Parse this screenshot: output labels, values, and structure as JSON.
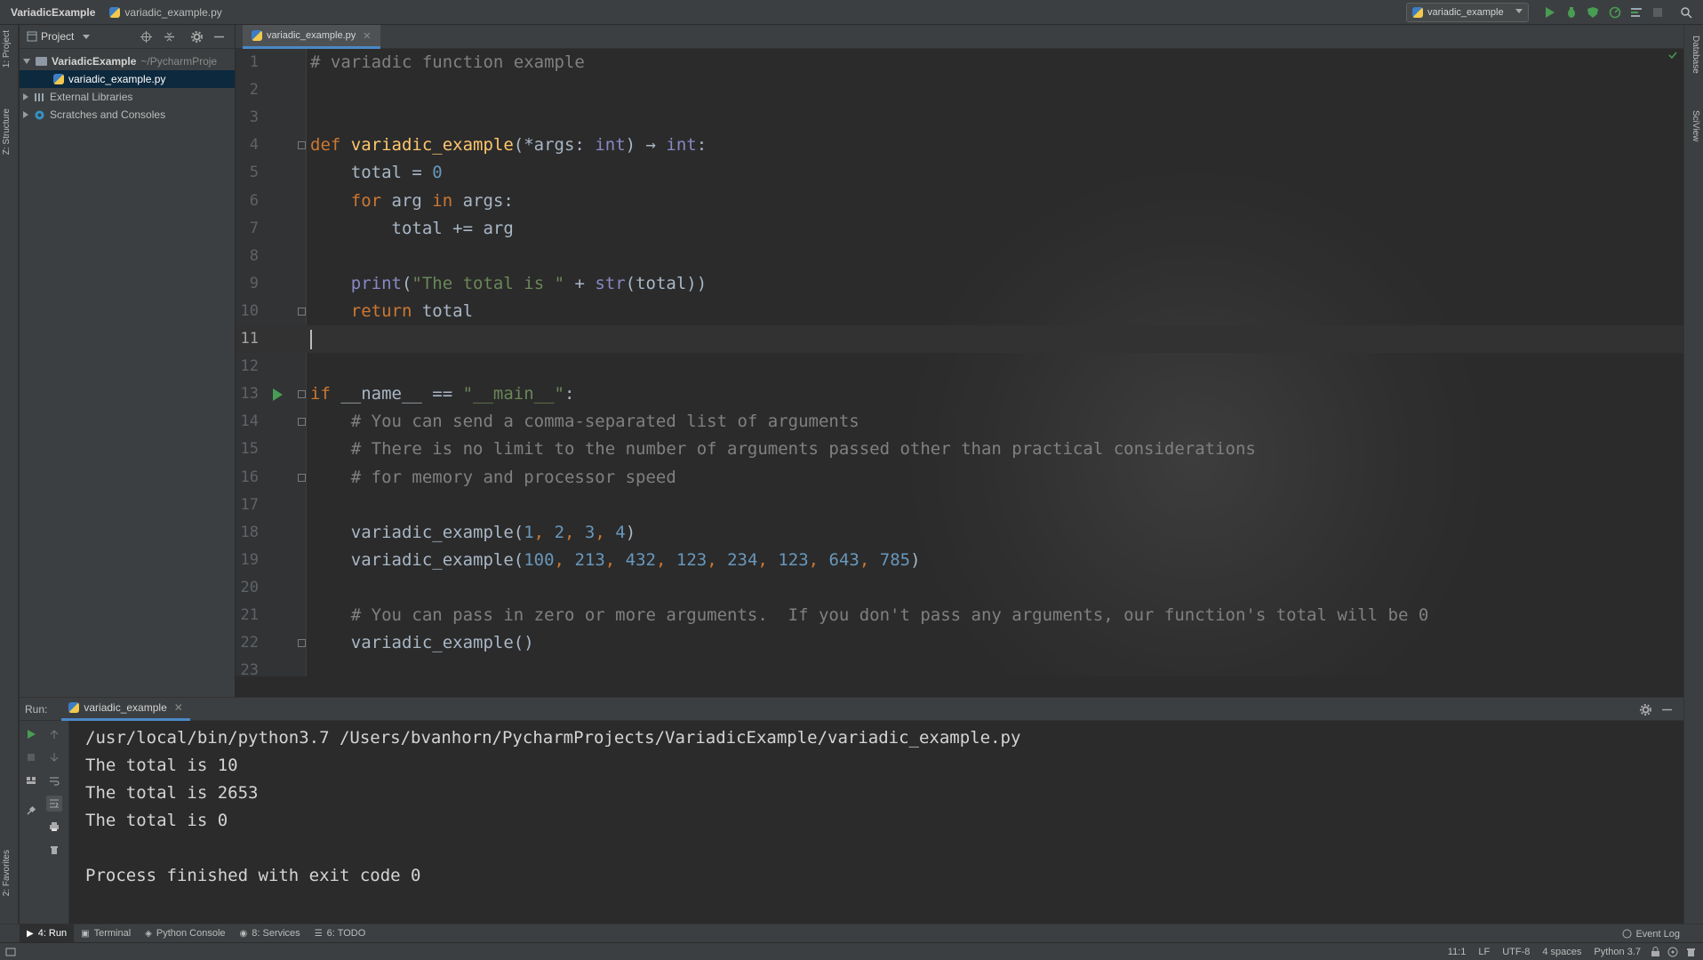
{
  "titlebar": {
    "project": "VariadicExample",
    "file": "variadic_example.py",
    "run_config": "variadic_example"
  },
  "left_stripe": {
    "project_tab": "1: Project",
    "structure_tab": "Z: Structure",
    "favorites_tab": "2: Favorites"
  },
  "right_stripe": {
    "database_tab": "Database",
    "sciview_tab": "SciView"
  },
  "project_panel": {
    "title": "Project",
    "tree": [
      {
        "label": "VariadicExample",
        "path": "~/PycharmProje"
      },
      {
        "label": "variadic_example.py"
      },
      {
        "label": "External Libraries"
      },
      {
        "label": "Scratches and Consoles"
      }
    ]
  },
  "editor": {
    "tab": "variadic_example.py",
    "current_line": 11,
    "lines": [
      {
        "n": "1",
        "s": [
          {
            "t": "# variadic function example",
            "c": "cm"
          }
        ]
      },
      {
        "n": "2",
        "s": []
      },
      {
        "n": "3",
        "s": []
      },
      {
        "n": "4",
        "s": [
          {
            "t": "def ",
            "c": "kw"
          },
          {
            "t": "variadic_example",
            "c": "fn"
          },
          {
            "t": "(*args: ",
            "c": ""
          },
          {
            "t": "int",
            "c": "bi"
          },
          {
            "t": ") → ",
            "c": ""
          },
          {
            "t": "int",
            "c": "bi"
          },
          {
            "t": ":",
            "c": ""
          }
        ]
      },
      {
        "n": "5",
        "s": [
          {
            "t": "    total = ",
            "c": ""
          },
          {
            "t": "0",
            "c": "nm"
          }
        ]
      },
      {
        "n": "6",
        "s": [
          {
            "t": "    ",
            "c": ""
          },
          {
            "t": "for",
            "c": "kw"
          },
          {
            "t": " arg ",
            "c": ""
          },
          {
            "t": "in",
            "c": "kw"
          },
          {
            "t": " args:",
            "c": ""
          }
        ]
      },
      {
        "n": "7",
        "s": [
          {
            "t": "        total += arg",
            "c": ""
          }
        ]
      },
      {
        "n": "8",
        "s": []
      },
      {
        "n": "9",
        "s": [
          {
            "t": "    ",
            "c": ""
          },
          {
            "t": "print",
            "c": "bi"
          },
          {
            "t": "(",
            "c": ""
          },
          {
            "t": "\"The total is \"",
            "c": "st"
          },
          {
            "t": " + ",
            "c": ""
          },
          {
            "t": "str",
            "c": "bi"
          },
          {
            "t": "(total))",
            "c": ""
          }
        ]
      },
      {
        "n": "10",
        "s": [
          {
            "t": "    ",
            "c": ""
          },
          {
            "t": "return",
            "c": "kw"
          },
          {
            "t": " total",
            "c": ""
          }
        ]
      },
      {
        "n": "11",
        "s": []
      },
      {
        "n": "12",
        "s": []
      },
      {
        "n": "13",
        "s": [
          {
            "t": "if",
            "c": "kw"
          },
          {
            "t": " __name__ == ",
            "c": ""
          },
          {
            "t": "\"__main__\"",
            "c": "st"
          },
          {
            "t": ":",
            "c": ""
          }
        ]
      },
      {
        "n": "14",
        "s": [
          {
            "t": "    ",
            "c": ""
          },
          {
            "t": "# You can send a comma-separated list of arguments",
            "c": "cm"
          }
        ]
      },
      {
        "n": "15",
        "s": [
          {
            "t": "    ",
            "c": ""
          },
          {
            "t": "# There is no limit to the number of arguments passed other than practical considerations",
            "c": "cm"
          }
        ]
      },
      {
        "n": "16",
        "s": [
          {
            "t": "    ",
            "c": ""
          },
          {
            "t": "# for memory and processor speed",
            "c": "cm"
          }
        ]
      },
      {
        "n": "17",
        "s": []
      },
      {
        "n": "18",
        "s": [
          {
            "t": "    variadic_example(",
            "c": ""
          },
          {
            "t": "1",
            "c": "nm"
          },
          {
            "t": ", ",
            "c": "kw"
          },
          {
            "t": "2",
            "c": "nm"
          },
          {
            "t": ", ",
            "c": "kw"
          },
          {
            "t": "3",
            "c": "nm"
          },
          {
            "t": ", ",
            "c": "kw"
          },
          {
            "t": "4",
            "c": "nm"
          },
          {
            "t": ")",
            "c": ""
          }
        ]
      },
      {
        "n": "19",
        "s": [
          {
            "t": "    variadic_example(",
            "c": ""
          },
          {
            "t": "100",
            "c": "nm"
          },
          {
            "t": ", ",
            "c": "kw"
          },
          {
            "t": "213",
            "c": "nm"
          },
          {
            "t": ", ",
            "c": "kw"
          },
          {
            "t": "432",
            "c": "nm"
          },
          {
            "t": ", ",
            "c": "kw"
          },
          {
            "t": "123",
            "c": "nm"
          },
          {
            "t": ", ",
            "c": "kw"
          },
          {
            "t": "234",
            "c": "nm"
          },
          {
            "t": ", ",
            "c": "kw"
          },
          {
            "t": "123",
            "c": "nm"
          },
          {
            "t": ", ",
            "c": "kw"
          },
          {
            "t": "643",
            "c": "nm"
          },
          {
            "t": ", ",
            "c": "kw"
          },
          {
            "t": "785",
            "c": "nm"
          },
          {
            "t": ")",
            "c": ""
          }
        ]
      },
      {
        "n": "20",
        "s": []
      },
      {
        "n": "21",
        "s": [
          {
            "t": "    ",
            "c": ""
          },
          {
            "t": "# You can pass in zero or more arguments.  If you don't pass any arguments, our function's total will be 0",
            "c": "cm"
          }
        ]
      },
      {
        "n": "22",
        "s": [
          {
            "t": "    variadic_example()",
            "c": ""
          }
        ]
      },
      {
        "n": "23",
        "s": []
      }
    ]
  },
  "run_panel": {
    "label": "Run:",
    "tab": "variadic_example",
    "output": [
      "/usr/local/bin/python3.7 /Users/bvanhorn/PycharmProjects/VariadicExample/variadic_example.py",
      "The total is 10",
      "The total is 2653",
      "The total is 0",
      "",
      "Process finished with exit code 0"
    ]
  },
  "bottom_tools": [
    {
      "label": "4: Run",
      "icon": "play-icon",
      "active": true
    },
    {
      "label": "Terminal",
      "icon": "terminal-icon",
      "active": false
    },
    {
      "label": "Python Console",
      "icon": "python-console-icon",
      "active": false
    },
    {
      "label": "8: Services",
      "icon": "services-icon",
      "active": false
    },
    {
      "label": "6: TODO",
      "icon": "todo-icon",
      "active": false
    }
  ],
  "event_log": "Event Log",
  "status": {
    "position": "11:1",
    "line_sep": "LF",
    "encoding": "UTF-8",
    "indent": "4 spaces",
    "interpreter": "Python 3.7"
  }
}
